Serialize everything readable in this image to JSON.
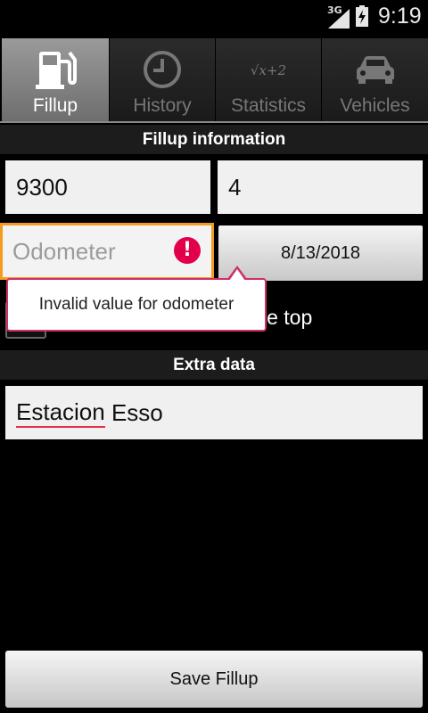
{
  "status_bar": {
    "network": "3G",
    "time": "9:19"
  },
  "tabs": [
    {
      "label": "Fillup",
      "icon": "fuel-pump-icon",
      "selected": true
    },
    {
      "label": "History",
      "icon": "clock-icon",
      "selected": false
    },
    {
      "label": "Statistics",
      "icon": "formula-icon",
      "selected": false
    },
    {
      "label": "Vehicles",
      "icon": "car-icon",
      "selected": false
    }
  ],
  "statistics_icon_text": "√x+2",
  "fillup_section": {
    "title": "Fillup information",
    "price_value": "9300",
    "volume_value": "4",
    "odometer_placeholder": "Odometer",
    "odometer_error_glyph": "!",
    "date_value": "8/13/2018",
    "error_message": "Invalid value for odometer",
    "partial_checkbox_label": "Tank was not filled to the top",
    "partial_checked": false
  },
  "extra_section": {
    "title": "Extra data",
    "comment_word1": "Estacion",
    "comment_word2": " Esso"
  },
  "save_button_label": "Save Fillup",
  "colors": {
    "error_border": "#f39c1f",
    "error_icon": "#e2004b",
    "popup_border": "#d02f6b"
  }
}
